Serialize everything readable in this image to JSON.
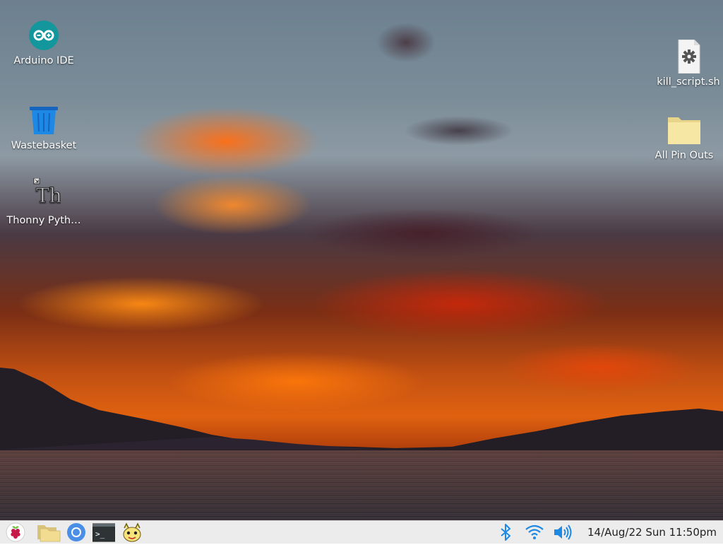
{
  "desktop": {
    "icons": [
      {
        "label": "Arduino IDE",
        "icon": "arduino-icon"
      },
      {
        "label": "Wastebasket",
        "icon": "wastebasket-icon"
      },
      {
        "label": "Thonny Pyth…",
        "icon": "thonny-icon"
      },
      {
        "label": "kill_script.sh",
        "icon": "shell-script-icon"
      },
      {
        "label": "All Pin Outs",
        "icon": "folder-icon"
      }
    ]
  },
  "taskbar": {
    "launchers": [
      {
        "icon": "raspberry-menu-icon"
      },
      {
        "icon": "file-manager-icon"
      },
      {
        "icon": "chromium-icon"
      },
      {
        "icon": "terminal-icon"
      },
      {
        "icon": "thonny-launcher-icon"
      }
    ],
    "tray": [
      {
        "icon": "bluetooth-icon"
      },
      {
        "icon": "wifi-icon"
      },
      {
        "icon": "volume-icon"
      }
    ],
    "clock": "14/Aug/22 Sun 11:50pm"
  },
  "colors": {
    "taskbar_bg": "#ececec",
    "tray_icon": "#1e88e5",
    "arduino_teal": "#14979c"
  }
}
